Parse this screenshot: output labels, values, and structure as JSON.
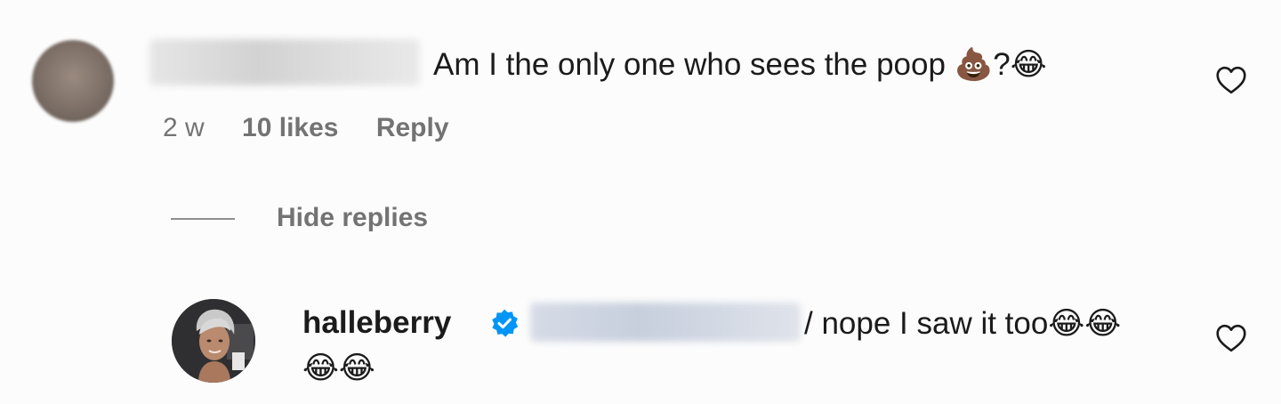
{
  "comment": {
    "text": "Am I the only one who sees the poop 💩?😂",
    "time": "2 w",
    "likes": "10 likes",
    "reply_label": "Reply"
  },
  "replies_toggle": {
    "label": "Hide replies"
  },
  "reply": {
    "username": "halleberry",
    "verified": true,
    "text_line1": "/ nope I saw it too😂😂",
    "text_line2": "😂😂"
  },
  "icons": {
    "like": "heart-outline-icon",
    "verified": "verified-badge-icon"
  },
  "colors": {
    "text": "#1b1b1b",
    "meta": "#737373",
    "verified": "#0095f6"
  }
}
